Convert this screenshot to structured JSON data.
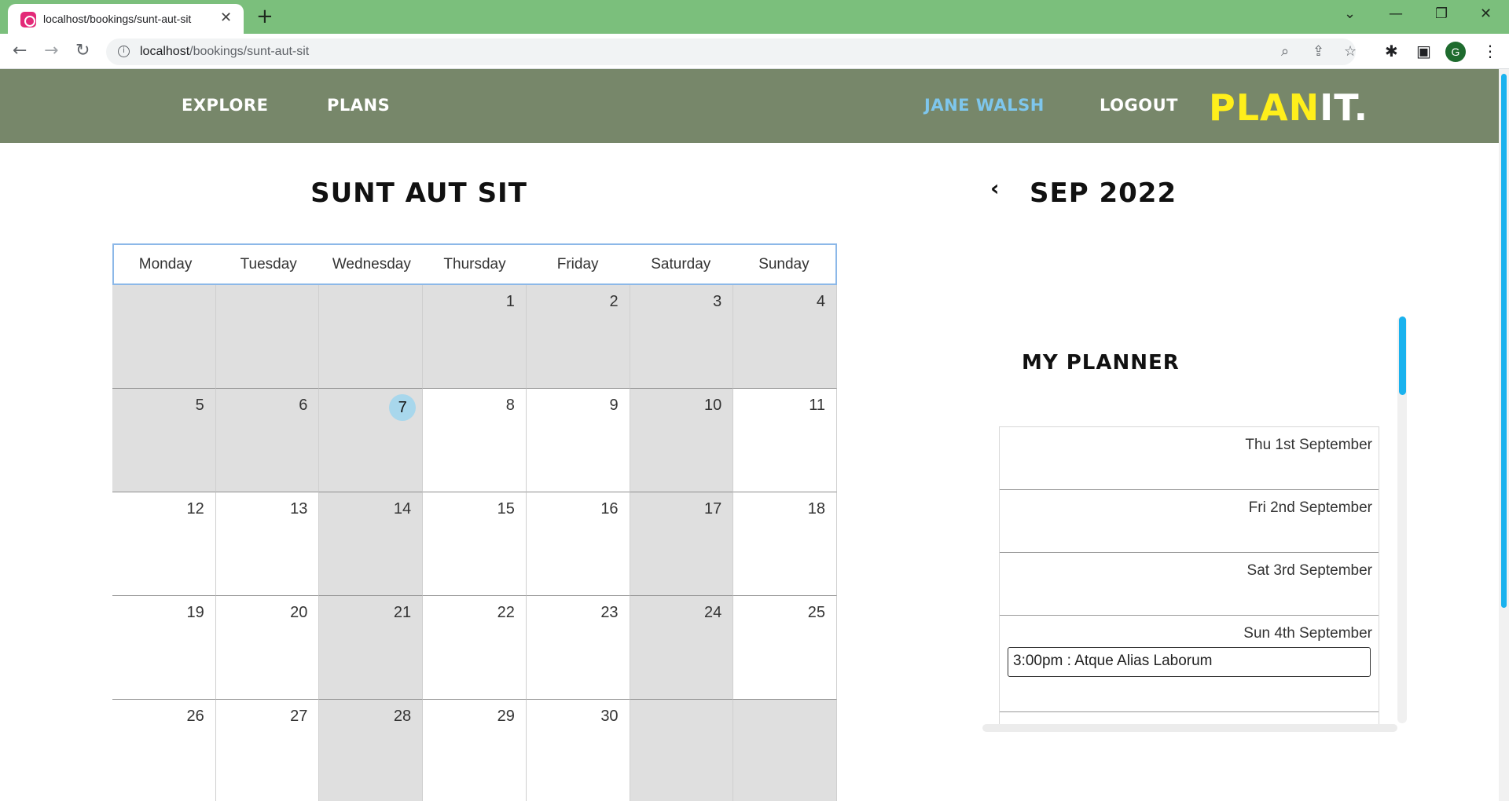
{
  "browser": {
    "tab_title": "localhost/bookings/sunt-aut-sit",
    "url_host": "localhost",
    "url_path": "/bookings/sunt-aut-sit",
    "profile_initial": "G"
  },
  "nav": {
    "explore": "EXPLORE",
    "plans": "PLANS",
    "user": "JANE WALSH",
    "logout": "LOGOUT",
    "logo_a": "PLAN",
    "logo_b": "IT."
  },
  "calendar": {
    "title": "SUNT AUT SIT",
    "month": "SEP 2022",
    "weekdays": [
      "Monday",
      "Tuesday",
      "Wednesday",
      "Thursday",
      "Friday",
      "Saturday",
      "Sunday"
    ],
    "cells": [
      "",
      "",
      "",
      "1",
      "2",
      "3",
      "4",
      "5",
      "6",
      "7",
      "8",
      "9",
      "10",
      "11",
      "12",
      "13",
      "14",
      "15",
      "16",
      "17",
      "18",
      "19",
      "20",
      "21",
      "22",
      "23",
      "24",
      "25",
      "26",
      "27",
      "28",
      "29",
      "30",
      "",
      ""
    ],
    "today": "7"
  },
  "planner": {
    "title": "MY PLANNER",
    "days": [
      {
        "date": "Thu 1st September",
        "event": ""
      },
      {
        "date": "Fri 2nd September",
        "event": ""
      },
      {
        "date": "Sat 3rd September",
        "event": ""
      },
      {
        "date": "Sun 4th September",
        "event": "3:00pm : Atque Alias Laborum"
      }
    ]
  },
  "colors": {
    "tabbar": "#7bbf7c",
    "header": "#77876a",
    "logo_yellow": "#ffef1b",
    "user_link": "#7ec6ec",
    "today_highlight": "#a8d7ec",
    "scroll_accent": "#1ab2ee"
  }
}
